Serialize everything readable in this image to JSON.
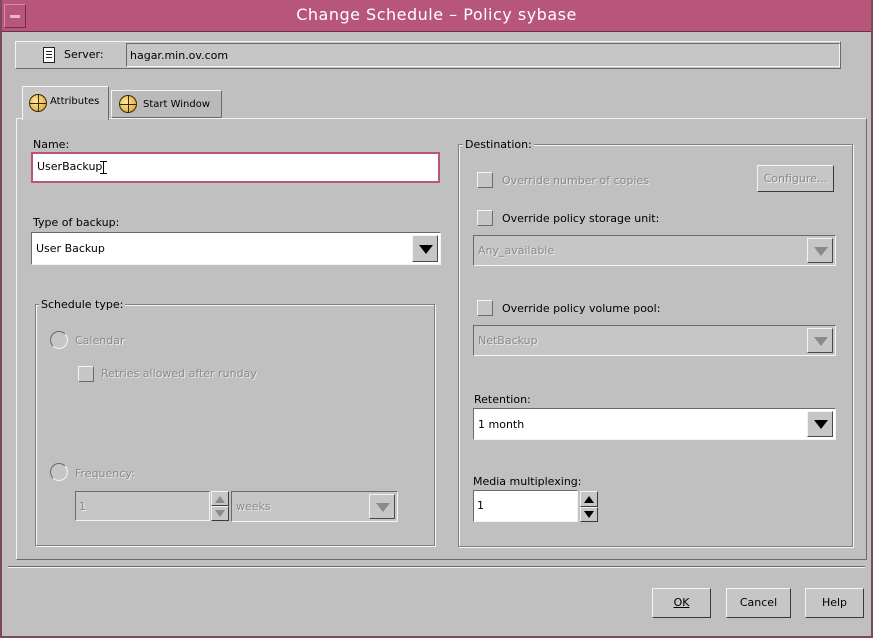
{
  "window": {
    "title": "Change Schedule – Policy sybase"
  },
  "server": {
    "label": "Server:",
    "value": "hagar.min.ov.com"
  },
  "tabs": [
    {
      "label": "Attributes",
      "selected": true
    },
    {
      "label": "Start Window",
      "selected": false
    }
  ],
  "attributes": {
    "name": {
      "label": "Name:",
      "value": "UserBackup"
    },
    "backup_type": {
      "label": "Type of backup:",
      "value": "User Backup"
    },
    "schedule_type": {
      "title": "Schedule type:",
      "calendar": {
        "label": "Calendar",
        "enabled": false
      },
      "retries": {
        "label": "Retries allowed after runday",
        "enabled": false
      },
      "frequency": {
        "label": "Frequency:",
        "value": "1",
        "unit": "weeks",
        "enabled": false
      }
    },
    "destination": {
      "title": "Destination:",
      "override_copies": {
        "label": "Override number of copies",
        "enabled": false
      },
      "configure_label": "Configure...",
      "override_storage": {
        "label": "Override policy storage unit:",
        "value": "Any_available"
      },
      "override_pool": {
        "label": "Override policy volume pool:",
        "value": "NetBackup"
      },
      "retention": {
        "label": "Retention:",
        "value": "1 month"
      },
      "multiplexing": {
        "label": "Media multiplexing:",
        "value": "1"
      }
    }
  },
  "buttons": {
    "ok": "OK",
    "cancel": "Cancel",
    "help": "Help"
  },
  "colors": {
    "titlebar": "#b8557a",
    "window_bg": "#c0c0c0",
    "focus_border": "#b8557a"
  }
}
